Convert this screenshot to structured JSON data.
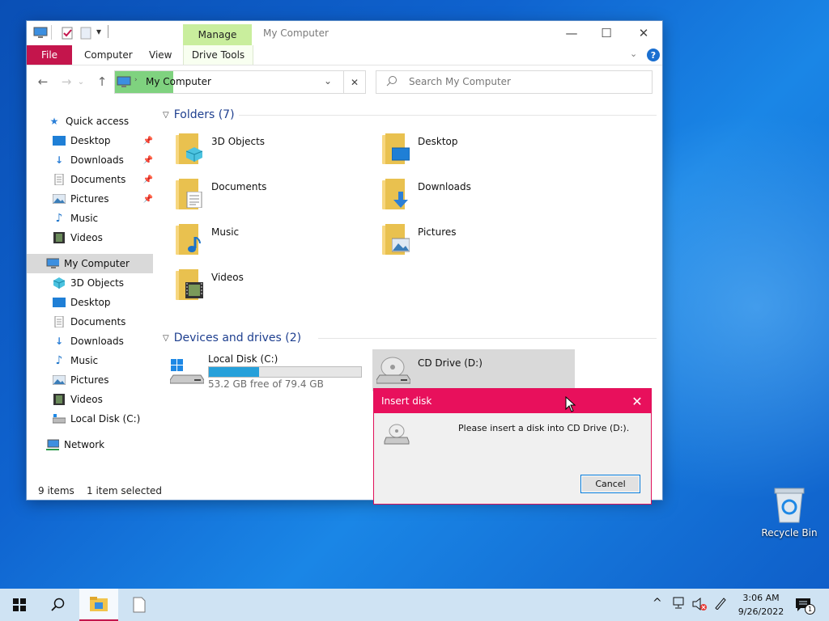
{
  "window": {
    "title": "My Computer",
    "manage_tab": "Manage",
    "ribbon_tabs": [
      "File",
      "Computer",
      "View",
      "Drive Tools"
    ]
  },
  "address": {
    "path": "My Computer",
    "search_placeholder": "Search My Computer"
  },
  "nav": {
    "quick_access": "Quick access",
    "quick_items": [
      "Desktop",
      "Downloads",
      "Documents",
      "Pictures",
      "Music",
      "Videos"
    ],
    "this_pc": "My Computer",
    "pc_items": [
      "3D Objects",
      "Desktop",
      "Documents",
      "Downloads",
      "Music",
      "Pictures",
      "Videos",
      "Local Disk (C:)"
    ],
    "network": "Network"
  },
  "content": {
    "folders_header": "Folders (7)",
    "folders": [
      "3D Objects",
      "Desktop",
      "Documents",
      "Downloads",
      "Music",
      "Pictures",
      "Videos"
    ],
    "devices_header": "Devices and drives (2)",
    "drives": [
      {
        "name": "Local Disk (C:)",
        "free": "53.2 GB free of 79.4 GB",
        "used_fraction": 0.33
      },
      {
        "name": "CD Drive (D:)"
      }
    ]
  },
  "status": {
    "items": "9 items",
    "selected": "1 item selected"
  },
  "dialog": {
    "title": "Insert disk",
    "message": "Please insert a disk into CD Drive (D:).",
    "cancel": "Cancel"
  },
  "desktop": {
    "recycle_bin": "Recycle Bin"
  },
  "taskbar": {
    "time": "3:06 AM",
    "date": "9/26/2022",
    "notification_count": "1"
  },
  "colors": {
    "file_tab": "#c4154c",
    "manage_tab": "#c9ee9d",
    "dialog_accent": "#e8105c",
    "drive_bar": "#26a0da"
  }
}
